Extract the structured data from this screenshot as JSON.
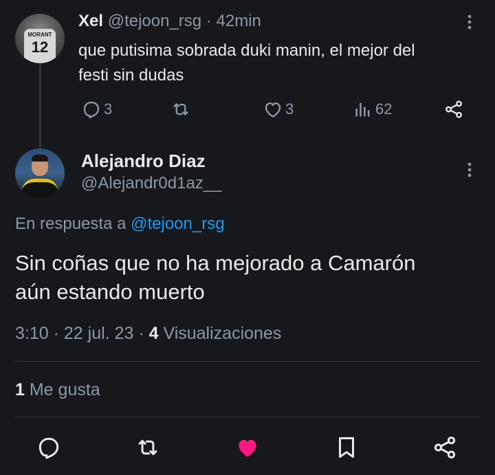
{
  "reply_tweet": {
    "display_name": "Xel",
    "handle": "@tejoon_rsg",
    "separator": "·",
    "time_ago": "42min",
    "text_line1": "que putisima sobrada duki manin, el mejor del",
    "text_line2": "festi sin dudas",
    "avatar_jersey_name": "MORANT",
    "avatar_jersey_number": "12",
    "replies": "3",
    "likes": "3",
    "views": "62"
  },
  "main_tweet": {
    "display_name": "Alejandro Diaz",
    "handle": "@Alejandr0d1az__",
    "reply_prefix": "En respuesta a",
    "reply_to": "@tejoon_rsg",
    "text_line1": "Sin coñas que no ha mejorado a Camarón",
    "text_line2": "aún estando muerto",
    "time": "3:10",
    "sep1": "·",
    "date": "22 jul. 23",
    "sep2": "·",
    "views_count": "4",
    "views_label": "Visualizaciones",
    "likes_count": "1",
    "likes_label": "Me gusta"
  },
  "colors": {
    "background": "#16181c",
    "text": "#e7e9ea",
    "muted": "#8b98a5",
    "link": "#1d9bf0",
    "like_active": "#f91880",
    "divider": "#2f3336"
  },
  "icons": {
    "reply": "reply-icon",
    "retweet": "retweet-icon",
    "like": "heart-icon",
    "views": "views-icon",
    "share": "share-icon",
    "more": "more-icon",
    "bookmark": "bookmark-icon"
  }
}
